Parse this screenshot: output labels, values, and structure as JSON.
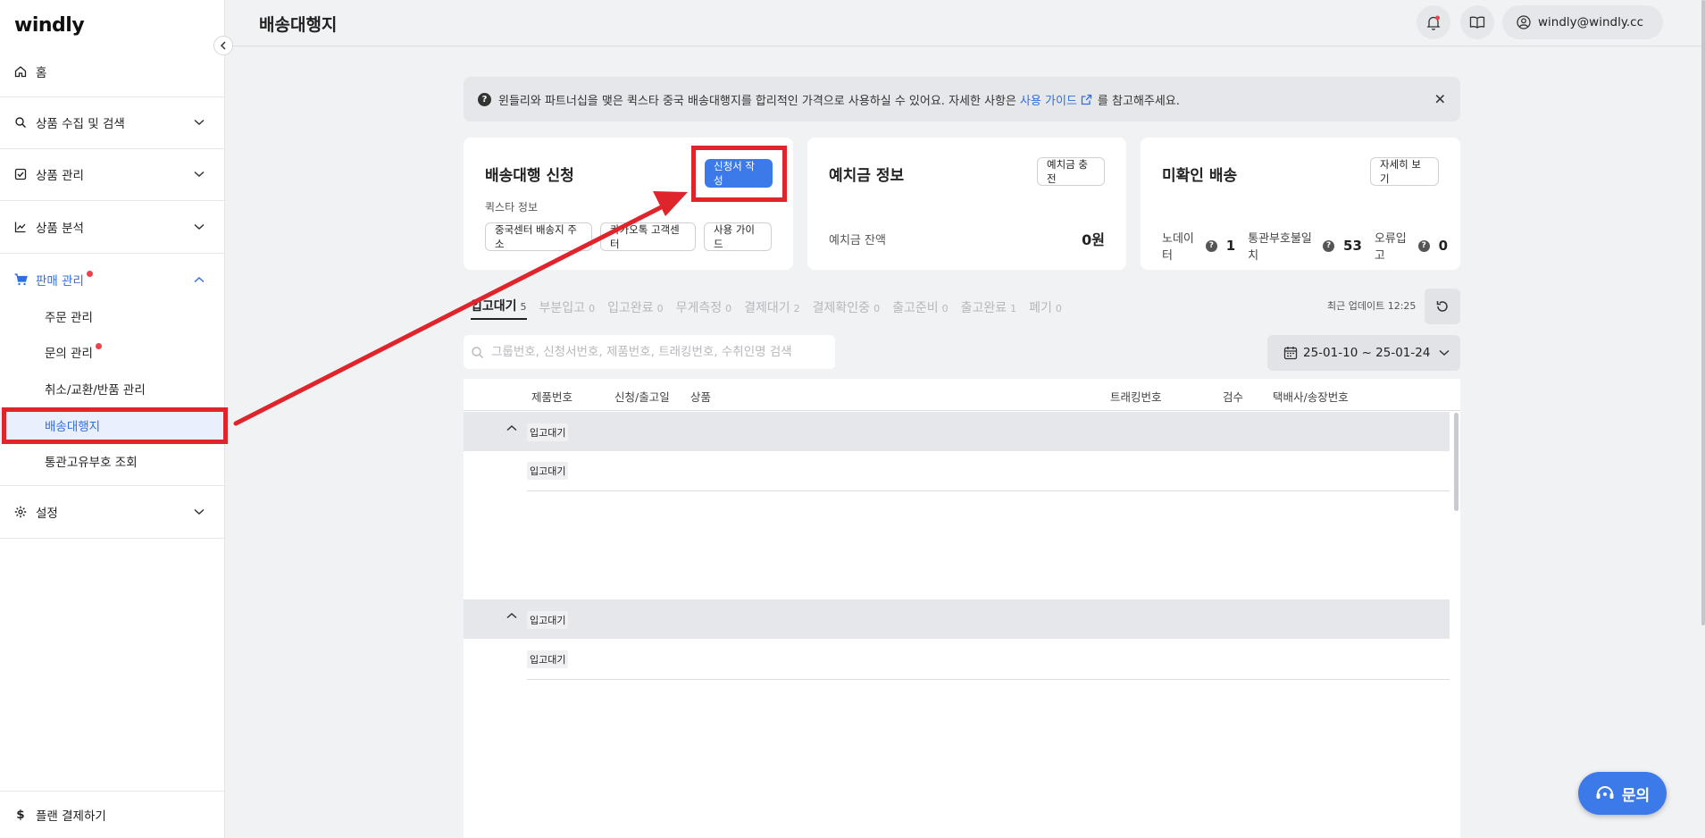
{
  "sidebar": {
    "logo": "windly",
    "home": "홈",
    "items": [
      {
        "label": "상품 수집 및 검색"
      },
      {
        "label": "상품 관리"
      },
      {
        "label": "상품 분석"
      },
      {
        "label": "판매 관리"
      },
      {
        "label": "설정"
      }
    ],
    "sub_items": [
      {
        "label": "주문 관리"
      },
      {
        "label": "문의 관리"
      },
      {
        "label": "취소/교환/반품 관리"
      },
      {
        "label": "배송대행지"
      },
      {
        "label": "통관고유부호 조회"
      }
    ],
    "plan": "플랜 결제하기"
  },
  "header": {
    "title": "배송대행지",
    "user_email": "windly@windly.cc"
  },
  "notice": {
    "text_before": "윈들리와 파트너십을 맺은 퀵스타 중국 배송대행지를 합리적인 가격으로 사용하실 수 있어요. 자세한 사항은",
    "link": "사용 가이드",
    "text_after": "를 참고해주세요."
  },
  "cards": {
    "request": {
      "title": "배송대행 신청",
      "write_button": "신청서 작성",
      "quickstar_label": "퀵스타 정보",
      "buttons": [
        "중국센터 배송지 주소",
        "카카오톡 고객센터",
        "사용 가이드"
      ]
    },
    "deposit": {
      "title": "예치금 정보",
      "charge_button": "예치금 충전",
      "balance_label": "예치금 잔액",
      "balance_value": "0원"
    },
    "unconfirmed": {
      "title": "미확인 배송",
      "detail_button": "자세히 보기",
      "stats": [
        {
          "label": "노데이터",
          "value": "1"
        },
        {
          "label": "통관부호불일치",
          "value": "53"
        },
        {
          "label": "오류입고",
          "value": "0"
        }
      ]
    }
  },
  "tabs": [
    {
      "label": "입고대기",
      "count": "5",
      "active": true
    },
    {
      "label": "부분입고",
      "count": "0"
    },
    {
      "label": "입고완료",
      "count": "0"
    },
    {
      "label": "무게측정",
      "count": "0"
    },
    {
      "label": "결제대기",
      "count": "2"
    },
    {
      "label": "결제확인중",
      "count": "0"
    },
    {
      "label": "출고준비",
      "count": "0"
    },
    {
      "label": "출고완료",
      "count": "1"
    },
    {
      "label": "폐기",
      "count": "0"
    }
  ],
  "last_update": "최근 업데이트 12:25",
  "search": {
    "placeholder": "그룹번호, 신청서번호, 제품번호, 트래킹번호, 수취인명 검색"
  },
  "date_range": "25-01-10 ~ 25-01-24",
  "table": {
    "headers": [
      "제품번호",
      "신청/출고일",
      "상품",
      "트래킹번호",
      "검수",
      "택배사/송장번호"
    ],
    "groups": [
      {
        "status": "입고대기",
        "rows": [
          {
            "status": "입고대기"
          }
        ]
      },
      {
        "status": "입고대기",
        "rows": [
          {
            "status": "입고대기"
          }
        ]
      }
    ]
  },
  "float_button": "문의",
  "colors": {
    "accent": "#3b7ae8",
    "highlight": "#e0242b",
    "badge": "#f0414b"
  }
}
